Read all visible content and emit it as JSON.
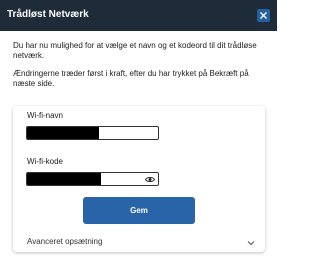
{
  "dialog": {
    "title": "Trådløst Netværk",
    "close_icon": "close-icon"
  },
  "intro": {
    "paragraph1": "Du har nu mulighed for at vælge et navn og et kodeord til dit trådløse netværk.",
    "paragraph2": "Ændringerne træder først i kraft, efter du har trykket på Bekræft på næste side."
  },
  "form": {
    "ssid_label": "Wi-fi-navn",
    "ssid_value": "",
    "password_label": "Wi-fi-kode",
    "password_value": "",
    "password_toggle_icon": "eye-icon",
    "save_label": "Gem",
    "advanced_label": "Avanceret opsætning",
    "advanced_icon": "chevron-down-icon"
  },
  "colors": {
    "titlebar": "#1e2b38",
    "close_button": "#25609f",
    "primary_button": "#2963a8"
  }
}
